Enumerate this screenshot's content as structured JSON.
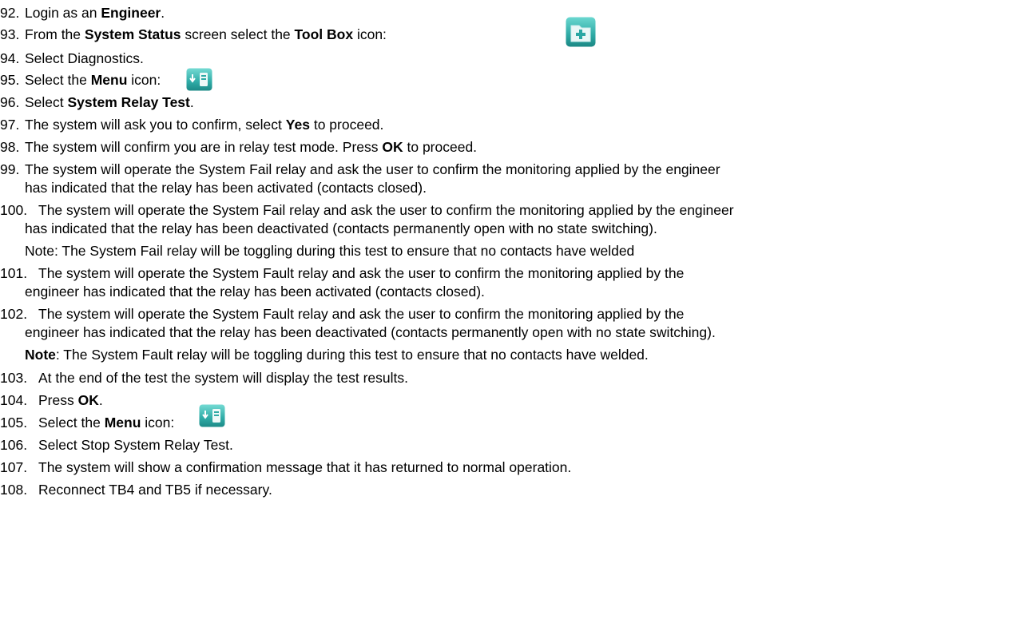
{
  "steps": {
    "s92": {
      "num": "92.",
      "pre": "Login as an ",
      "bold": "Engineer",
      "post": "."
    },
    "s93": {
      "num": "93.",
      "pre": "From the ",
      "bold1": "System Status",
      "mid": " screen select the ",
      "bold2": "Tool Box",
      "post": " icon:"
    },
    "s94": {
      "num": "94.",
      "text": "Select Diagnostics."
    },
    "s95": {
      "num": "95.",
      "pre": "Select the ",
      "bold": "Menu",
      "post": " icon:"
    },
    "s96": {
      "num": "96.",
      "pre": "Select ",
      "bold": "System Relay Test",
      "post": "."
    },
    "s97": {
      "num": "97.",
      "pre": "The system will ask you to confirm, select ",
      "bold": "Yes",
      "post": " to proceed."
    },
    "s98": {
      "num": "98.",
      "pre": "The system will confirm you are in relay test mode. Press ",
      "bold": "OK",
      "post": " to proceed."
    },
    "s99": {
      "num": "99.",
      "line1": "The system will operate the System Fail relay and ask the user to confirm the monitoring applied by the engineer",
      "line2": "has indicated that the relay has been activated (contacts closed)."
    },
    "s100": {
      "num": "100.",
      "line1": "The system will operate the System Fail relay and ask the user to confirm the monitoring applied by the engineer",
      "line2": "has indicated that the relay has been deactivated (contacts permanently open with no state switching).",
      "note": "Note: The System Fail relay will be toggling during this test to ensure that no contacts have welded"
    },
    "s101": {
      "num": "101.",
      "line1": "The system will operate the System Fault relay and ask the user to confirm the monitoring applied by the",
      "line2": "engineer has indicated that the relay has been activated (contacts closed)."
    },
    "s102": {
      "num": "102.",
      "line1": "The system will operate the System Fault relay and ask the user to confirm the monitoring applied by the",
      "line2": "engineer has indicated that the relay has been deactivated (contacts permanently open with no state switching).",
      "note_bold": "Note",
      "note_rest": ": The System Fault relay will be toggling during this test to ensure that no contacts have welded."
    },
    "s103": {
      "num": "103.",
      "text": "At the end of the test the system will display the test results."
    },
    "s104": {
      "num": "104.",
      "pre": "Press ",
      "bold": "OK",
      "post": "."
    },
    "s105": {
      "num": "105.",
      "pre": "Select the ",
      "bold": "Menu",
      "post": " icon:"
    },
    "s106": {
      "num": "106.",
      "text": "Select Stop System Relay Test."
    },
    "s107": {
      "num": "107.",
      "text": "The system will show a confirmation message that it has returned to normal operation."
    },
    "s108": {
      "num": "108.",
      "text": "Reconnect TB4 and TB5 if necessary."
    }
  },
  "icons": {
    "toolbox": "toolbox-icon",
    "menu": "menu-icon",
    "accent": "#2aa7a3"
  }
}
